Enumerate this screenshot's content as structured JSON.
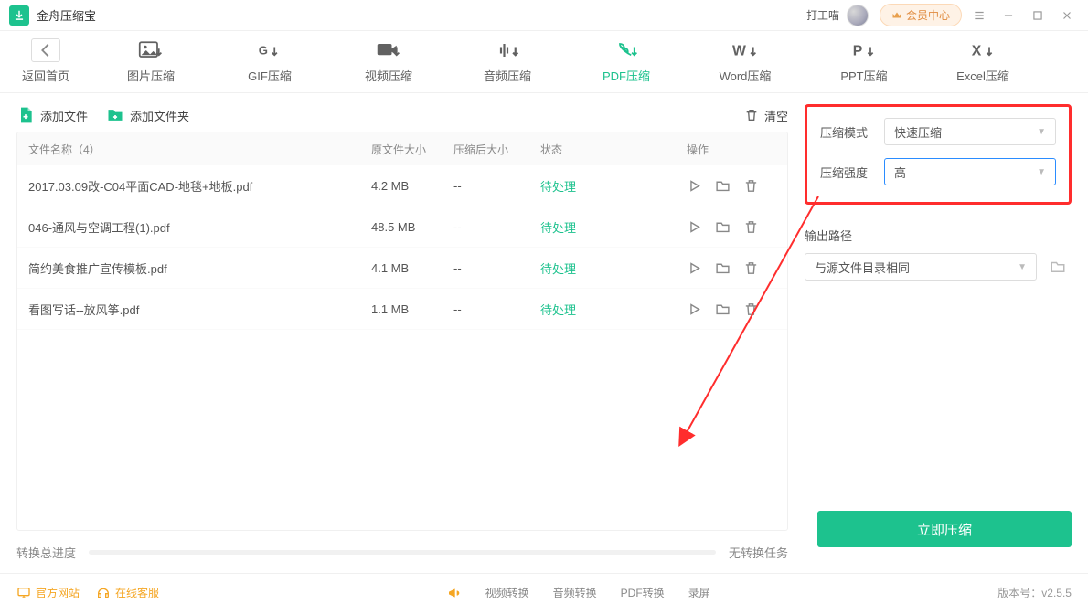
{
  "app": {
    "title": "金舟压缩宝",
    "user": "打工喵",
    "vip": "会员中心"
  },
  "nav": {
    "back": "返回首页",
    "items": [
      {
        "label": "图片压缩"
      },
      {
        "label": "GIF压缩"
      },
      {
        "label": "视频压缩"
      },
      {
        "label": "音频压缩"
      },
      {
        "label": "PDF压缩",
        "active": true
      },
      {
        "label": "Word压缩"
      },
      {
        "label": "PPT压缩"
      },
      {
        "label": "Excel压缩"
      }
    ]
  },
  "toolbar": {
    "add_file": "添加文件",
    "add_folder": "添加文件夹",
    "clear": "清空"
  },
  "table": {
    "headers": {
      "name": "文件名称（4）",
      "orig": "原文件大小",
      "after": "压缩后大小",
      "status": "状态",
      "ops": "操作"
    },
    "rows": [
      {
        "name": "2017.03.09改-C04平面CAD-地毯+地板.pdf",
        "orig": "4.2 MB",
        "after": "--",
        "status": "待处理"
      },
      {
        "name": "046-通风与空调工程(1).pdf",
        "orig": "48.5 MB",
        "after": "--",
        "status": "待处理"
      },
      {
        "name": "简约美食推广宣传模板.pdf",
        "orig": "4.1 MB",
        "after": "--",
        "status": "待处理"
      },
      {
        "name": "看图写话--放风筝.pdf",
        "orig": "1.1 MB",
        "after": "--",
        "status": "待处理"
      }
    ]
  },
  "progress": {
    "label": "转换总进度",
    "status": "无转换任务"
  },
  "settings": {
    "mode_label": "压缩模式",
    "mode_value": "快速压缩",
    "strength_label": "压缩强度",
    "strength_value": "高",
    "output_label": "输出路径",
    "output_value": "与源文件目录相同",
    "compress_btn": "立即压缩"
  },
  "footer": {
    "website": "官方网站",
    "service": "在线客服",
    "video": "视频转换",
    "audio": "音频转换",
    "pdf": "PDF转换",
    "screen": "录屏",
    "version": "版本号：v2.5.5"
  }
}
